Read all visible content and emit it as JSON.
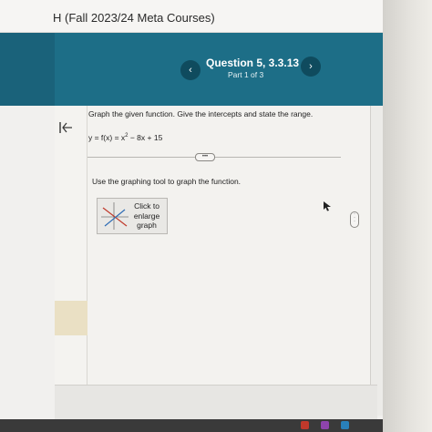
{
  "header": {
    "course_title": "H (Fall 2023/24 Meta Courses)"
  },
  "question_nav": {
    "title": "Question 5, 3.3.13",
    "part": "Part 1 of 3",
    "prev_glyph": "‹",
    "next_glyph": "›"
  },
  "problem": {
    "instructions": "Graph the given function. Give the intercepts and state the range.",
    "function_lhs": "y = f(x) = x",
    "function_exp": "2",
    "function_rhs": " − 8x + 15",
    "more_label": "•••",
    "tool_note": "Use the graphing tool to graph the function.",
    "graph_button_label": "Click to enlarge graph"
  },
  "colors": {
    "teal_header": "#1d6e87",
    "nav_button": "#0f4b5e",
    "graph_line_red": "#c0392b",
    "graph_line_blue": "#2f6db5"
  },
  "icons": {
    "collapse": "collapse-left-icon",
    "cursor": "mouse-cursor-icon",
    "graph_thumbnail": "graph-thumbnail-icon"
  }
}
